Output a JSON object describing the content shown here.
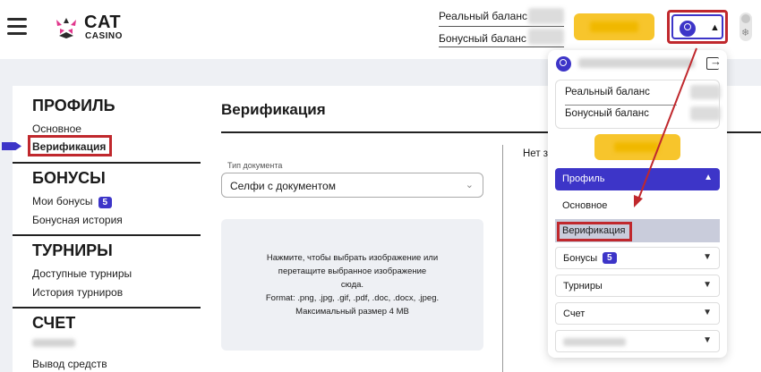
{
  "header": {
    "logo_text_main": "CAT",
    "logo_text_sub": "CASINO",
    "real_balance_label": "Реальный баланс",
    "bonus_balance_label": "Бонусный баланс"
  },
  "sidebar": {
    "sections": [
      {
        "title": "ПРОФИЛЬ",
        "links": [
          "Основное",
          "Верификация"
        ]
      },
      {
        "title": "БОНУСЫ",
        "links": [
          "Мои бонусы",
          "Бонусная история"
        ],
        "badge": "5"
      },
      {
        "title": "ТУРНИРЫ",
        "links": [
          "Доступные турниры",
          "История турниров"
        ]
      },
      {
        "title": "СЧЕТ",
        "links": [
          "Вывод средств"
        ]
      }
    ],
    "active_link": "Верификация"
  },
  "main": {
    "title": "Верификация",
    "doc_type_label": "Тип документа",
    "doc_type_value": "Селфи с документом",
    "upload_lines": [
      "Нажмите, чтобы выбрать изображение или",
      "перетащите выбранное изображение",
      "сюда.",
      "Format: .png, .jpg, .gif, .pdf, .doc, .docx, .jpeg.",
      "Максимальный размер 4 MB"
    ],
    "right_text": "Нет з"
  },
  "dropdown": {
    "real_balance_label": "Реальный баланс",
    "bonus_balance_label": "Бонусный баланс",
    "profile_label": "Профиль",
    "profile_sub": [
      "Основное",
      "Верификация"
    ],
    "items": [
      {
        "label": "Бонусы",
        "badge": "5"
      },
      {
        "label": "Турниры"
      },
      {
        "label": "Счет"
      }
    ]
  },
  "colors": {
    "accent": "#3d35c8",
    "deposit": "#f7c52c",
    "highlight": "#c0282d"
  }
}
